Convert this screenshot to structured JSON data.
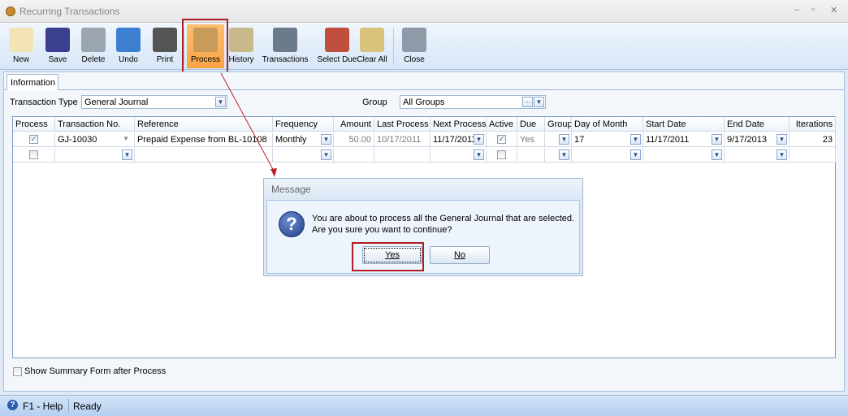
{
  "window": {
    "title": "Recurring Transactions"
  },
  "toolbar": [
    {
      "label": "New",
      "icon": "new-document-icon"
    },
    {
      "label": "Save",
      "icon": "floppy-disk-icon"
    },
    {
      "label": "Delete",
      "icon": "trash-can-icon"
    },
    {
      "label": "Undo",
      "icon": "undo-arrow-icon"
    },
    {
      "label": "Print",
      "icon": "printer-icon"
    },
    {
      "label": "Process",
      "icon": "process-gear-icon"
    },
    {
      "label": "History",
      "icon": "history-hourglass-icon"
    },
    {
      "label": "Transactions",
      "icon": "transactions-register-icon"
    },
    {
      "label": "Select Due",
      "icon": "select-due-icon"
    },
    {
      "label": "Clear All",
      "icon": "clear-all-clipboard-icon"
    },
    {
      "label": "Close",
      "icon": "close-window-icon"
    }
  ],
  "tabs": [
    {
      "label": "Information"
    }
  ],
  "filters": {
    "type_label": "Transaction Type",
    "type_value": "General Journal",
    "group_label": "Group",
    "group_value": "All Groups"
  },
  "grid": {
    "columns": [
      "Process",
      "Transaction No.",
      "Reference",
      "Frequency",
      "Amount",
      "Last Process",
      "Next Process",
      "Active",
      "Due",
      "Group",
      "Day of Month",
      "Start Date",
      "End Date",
      "Iterations"
    ],
    "rows": [
      {
        "process": true,
        "trans_no": "GJ-10030",
        "reference": "Prepaid Expense from BL-10108",
        "frequency": "Monthly",
        "amount": "50.00",
        "last_process": "10/17/2011",
        "next_process": "11/17/2011",
        "active": true,
        "due": "Yes",
        "group": "",
        "day_of_month": "17",
        "start_date": "11/17/2011",
        "end_date": "9/17/2013",
        "iterations": "23"
      },
      {
        "process": false,
        "active": false
      }
    ]
  },
  "summary_checkbox": {
    "label": "Show Summary Form after Process",
    "checked": false
  },
  "dialog": {
    "title": "Message",
    "line1": "You are about to process all the General Journal that are selected.",
    "line2": "Are you sure you want to continue?",
    "yes": "Yes",
    "no": "No",
    "icon": "question-icon"
  },
  "status": {
    "help": "F1 - Help",
    "state": "Ready"
  },
  "colors": {
    "highlight": "#b01c24",
    "process_active": "#f8a445"
  }
}
